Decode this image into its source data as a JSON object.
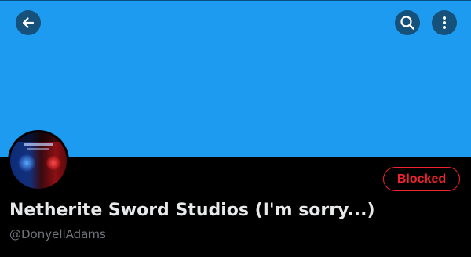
{
  "header": {
    "back_icon": "arrow-left-icon",
    "search_icon": "search-icon",
    "more_icon": "more-vertical-icon"
  },
  "banner": {
    "color": "#1d9bf0"
  },
  "profile": {
    "display_name": "Netherite Sword Studios (I'm sorry...)",
    "handle": "@DonyellAdams",
    "blocked_label": "Blocked",
    "blocked_color": "#f4212e"
  }
}
